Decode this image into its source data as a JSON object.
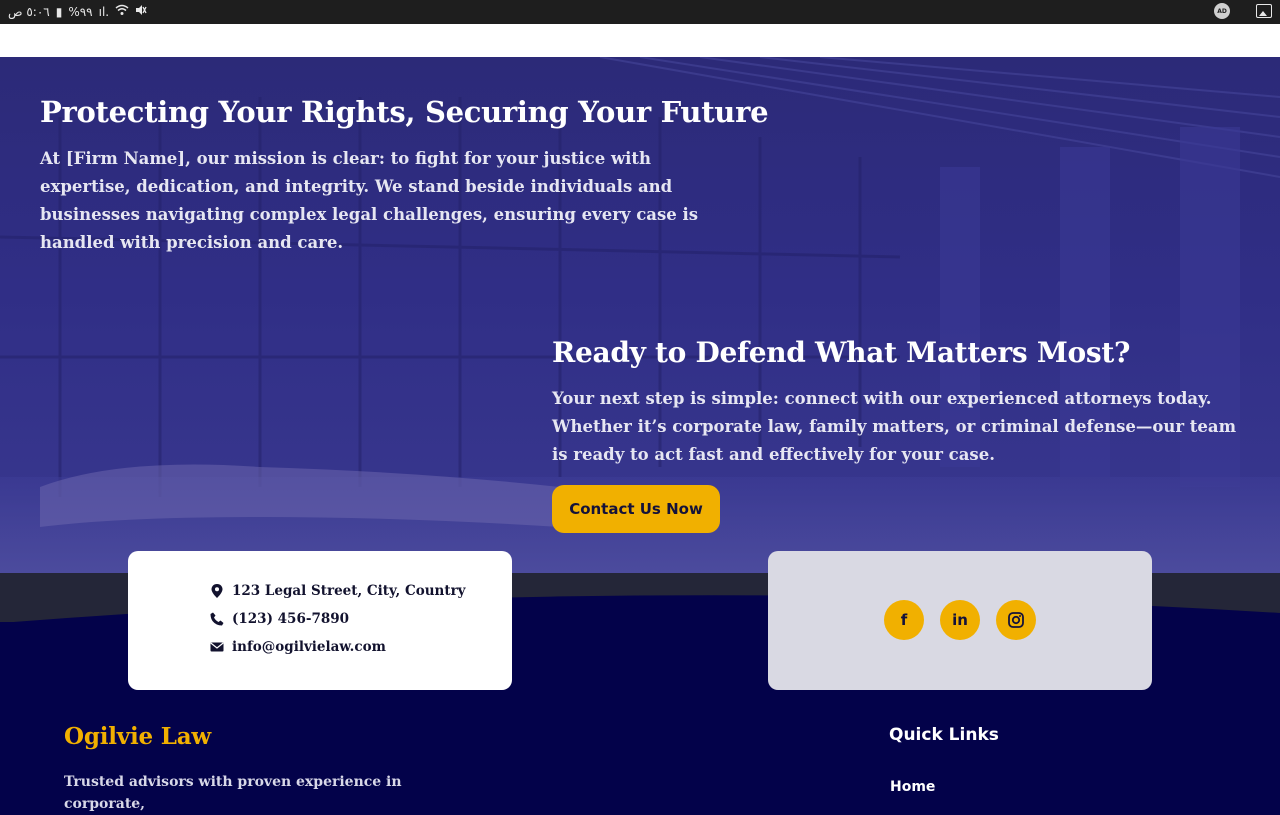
{
  "status_bar": {
    "time": "٥:٠٦ ص",
    "battery": "%٩٩",
    "ad_badge": "AD"
  },
  "hero": {
    "title": "Protecting Your Rights, Securing Your Future",
    "mission": "At [Firm Name], our mission is clear: to fight for your justice with expertise, dedication, and integrity. We stand beside individuals and businesses navigating complex legal challenges, ensuring every case is handled with precision and care.",
    "cta_title": "Ready to Defend What Matters Most?",
    "cta_text": "Your next step is simple: connect with our experienced attorneys today. Whether it’s corporate law, family matters, or criminal defense—our team is ready to act fast and effectively for your case.",
    "cta_button": "Contact Us Now"
  },
  "contact": {
    "address": "123 Legal Street, City, Country",
    "phone": "(123) 456-7890",
    "email": "info@ogilvielaw.com"
  },
  "social": {
    "facebook": "f",
    "linkedin": "in"
  },
  "footer": {
    "brand": "Ogilvie Law",
    "tagline": "Trusted advisors with proven experience in corporate,",
    "quick_links_title": "Quick Links",
    "links": [
      {
        "label": "Home"
      }
    ]
  },
  "colors": {
    "accent": "#f1b000",
    "navy": "#03024a",
    "hero_overlay": "#302e86"
  }
}
